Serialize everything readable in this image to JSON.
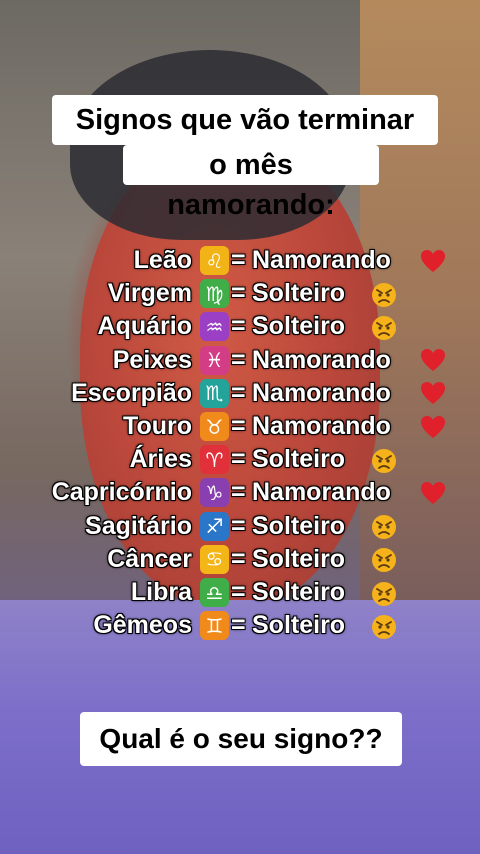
{
  "title": {
    "line1": "Signos que vão terminar",
    "line2": "o mês namorando:"
  },
  "question": "Qual é o seu signo??",
  "signs": [
    {
      "sign": "Leão",
      "symbol": "♌",
      "symbol_icon": "leo-icon",
      "icon_color": "#f2b316",
      "status": "Namorando",
      "emoji": "heart-icon"
    },
    {
      "sign": "Virgem",
      "symbol": "♍",
      "symbol_icon": "virgo-icon",
      "icon_color": "#3fae49",
      "status": "Solteiro",
      "emoji": "angry-face-icon"
    },
    {
      "sign": "Aquário",
      "symbol": "♒",
      "symbol_icon": "aquarius-icon",
      "icon_color": "#9b3fc4",
      "status": "Solteiro",
      "emoji": "angry-face-icon"
    },
    {
      "sign": "Peixes",
      "symbol": "♓",
      "symbol_icon": "pisces-icon",
      "icon_color": "#d33d86",
      "status": "Namorando",
      "emoji": "heart-icon"
    },
    {
      "sign": "Escorpião",
      "symbol": "♏",
      "symbol_icon": "scorpio-icon",
      "icon_color": "#23a39a",
      "status": "Namorando",
      "emoji": "heart-icon"
    },
    {
      "sign": "Touro",
      "symbol": "♉",
      "symbol_icon": "taurus-icon",
      "icon_color": "#f08a1a",
      "status": "Namorando",
      "emoji": "heart-icon"
    },
    {
      "sign": "Áries",
      "symbol": "♈",
      "symbol_icon": "aries-icon",
      "icon_color": "#e0303a",
      "status": "Solteiro",
      "emoji": "angry-face-icon"
    },
    {
      "sign": "Capricórnio",
      "symbol": "♑",
      "symbol_icon": "capricorn-icon",
      "icon_color": "#8a3fb0",
      "status": "Namorando",
      "emoji": "heart-icon"
    },
    {
      "sign": "Sagitário",
      "symbol": "♐",
      "symbol_icon": "sagittarius-icon",
      "icon_color": "#2a76c9",
      "status": "Solteiro",
      "emoji": "angry-face-icon"
    },
    {
      "sign": "Câncer",
      "symbol": "♋",
      "symbol_icon": "cancer-icon",
      "icon_color": "#f4b516",
      "status": "Solteiro",
      "emoji": "angry-face-icon"
    },
    {
      "sign": "Libra",
      "symbol": "♎",
      "symbol_icon": "libra-icon",
      "icon_color": "#3fae49",
      "status": "Solteiro",
      "emoji": "angry-face-icon"
    },
    {
      "sign": "Gêmeos",
      "symbol": "♊",
      "symbol_icon": "gemini-icon",
      "icon_color": "#f08a1a",
      "status": "Solteiro",
      "emoji": "angry-face-icon"
    }
  ],
  "colors": {
    "heart": "#e0202b",
    "angry": "#f6b21a",
    "text": "#ffffff"
  }
}
